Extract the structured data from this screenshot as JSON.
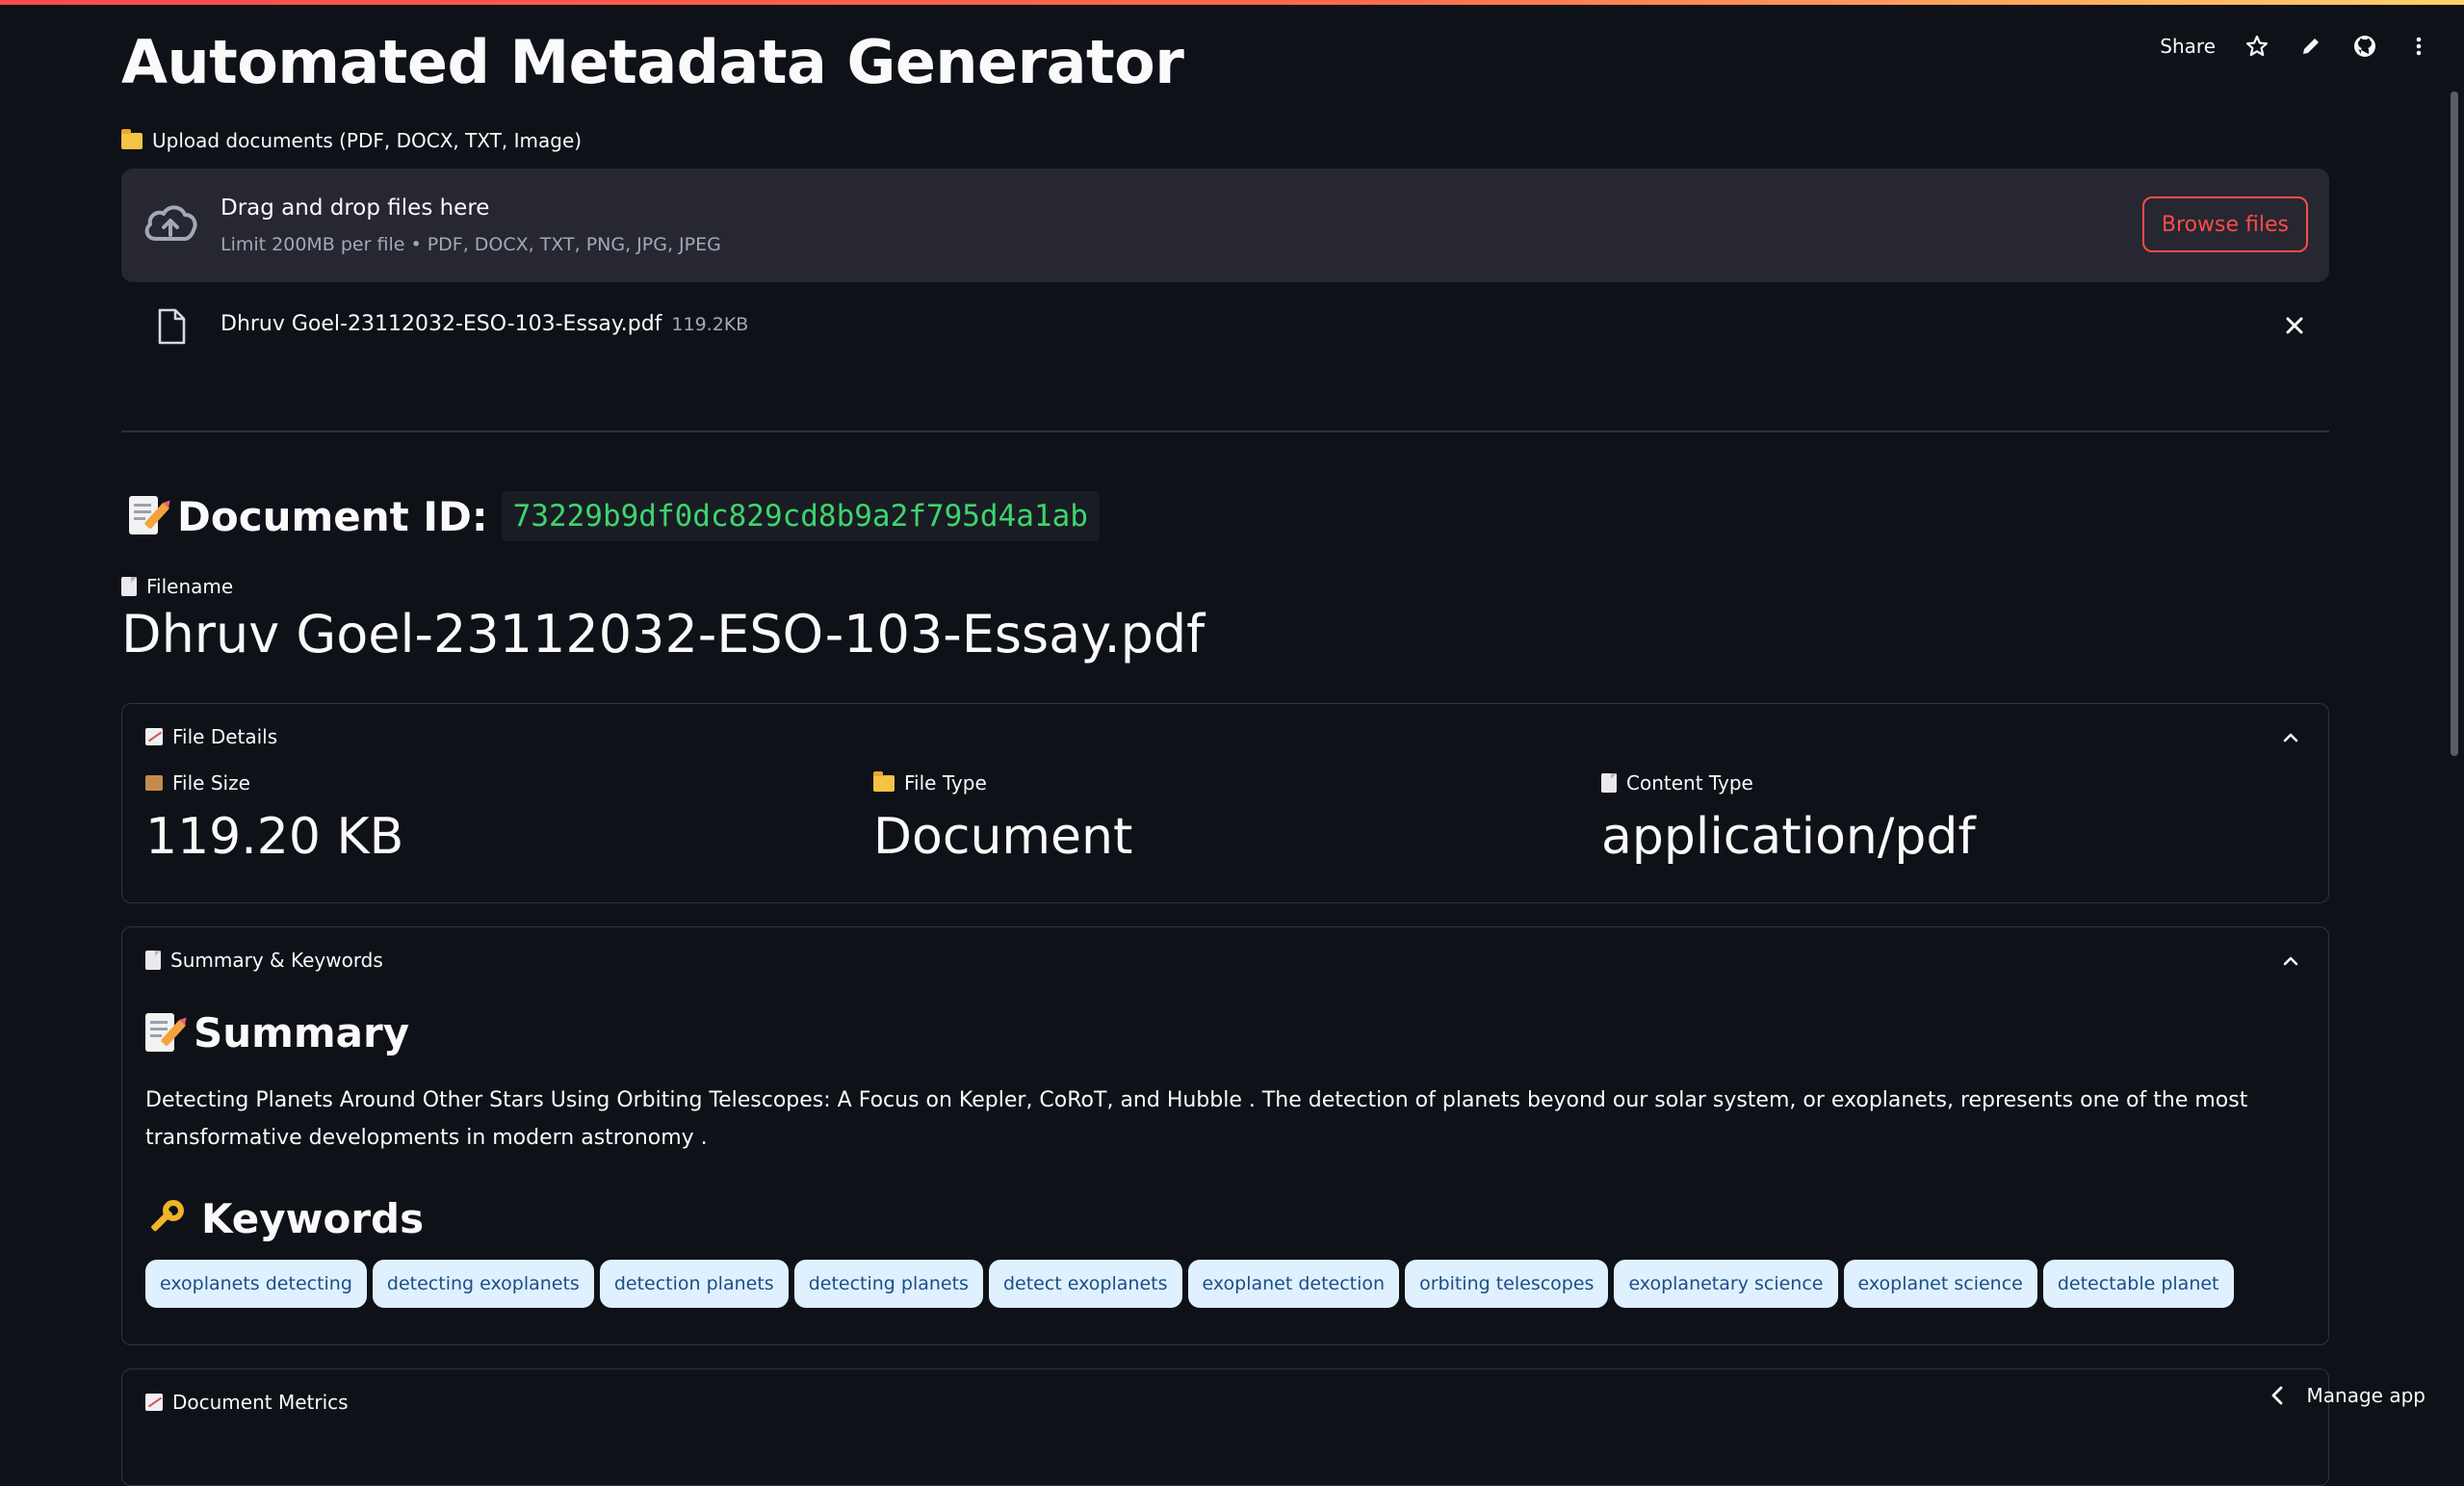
{
  "app": {
    "title": "Automated Metadata Generator"
  },
  "toolbar": {
    "share_label": "Share",
    "icons": [
      "star-icon",
      "pencil-icon",
      "github-icon",
      "more-vertical-icon"
    ]
  },
  "uploader": {
    "label": "Upload documents (PDF, DOCX, TXT, Image)",
    "drop_title": "Drag and drop files here",
    "drop_hint": "Limit 200MB per file • PDF, DOCX, TXT, PNG, JPG, JPEG",
    "browse_label": "Browse files",
    "file": {
      "name": "Dhruv Goel-23112032-ESO-103-Essay.pdf",
      "size": "119.2KB"
    }
  },
  "document": {
    "id_label": "Document ID:",
    "id_value": "73229b9df0dc829cd8b9a2f795d4a1ab",
    "filename_label": "Filename",
    "filename_value": "Dhruv Goel-23112032-ESO-103-Essay.pdf"
  },
  "file_details": {
    "title": "File Details",
    "metrics": [
      {
        "label": "File Size",
        "value": "119.20 KB"
      },
      {
        "label": "File Type",
        "value": "Document"
      },
      {
        "label": "Content Type",
        "value": "application/pdf"
      }
    ]
  },
  "summary_keywords": {
    "title": "Summary & Keywords",
    "summary_heading": "Summary",
    "summary_text": "Detecting Planets Around Other Stars Using Orbiting Telescopes: A Focus on Kepler, CoRoT, and Hubble . The detection of planets beyond our solar system, or exoplanets, represents one of the most transformative developments in modern astronomy .",
    "keywords_heading": "Keywords",
    "keywords": [
      "exoplanets detecting",
      "detecting exoplanets",
      "detection planets",
      "detecting planets",
      "detect exoplanets",
      "exoplanet detection",
      "orbiting telescopes",
      "exoplanetary science",
      "exoplanet science",
      "detectable planet"
    ]
  },
  "document_metrics": {
    "title": "Document Metrics"
  },
  "footer": {
    "manage_app_label": "Manage app"
  }
}
